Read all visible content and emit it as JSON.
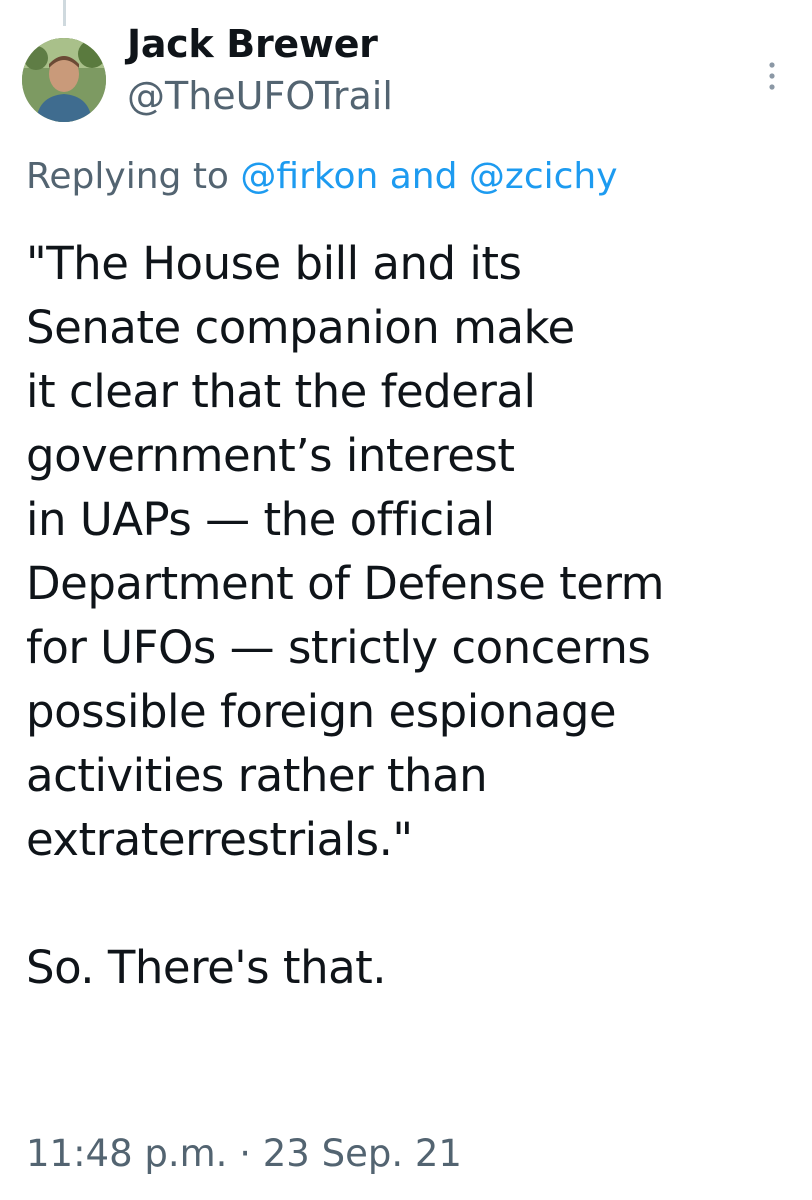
{
  "author": {
    "display_name": "Jack Brewer",
    "handle": "@TheUFOTrail",
    "avatar_icon": "profile-photo"
  },
  "reply": {
    "prefix": "Replying to ",
    "mentions": [
      "@firkon",
      "@zcichy"
    ],
    "joiner": " and "
  },
  "tweet": {
    "lines": [
      "\"The House bill and its",
      "Senate companion make",
      "it clear that the federal",
      "government’s interest",
      "in UAPs — the official",
      "Department of Defense term",
      "for UFOs — strictly concerns",
      "possible foreign espionage",
      "activities rather than",
      "extraterrestrials.\""
    ],
    "closing": "So. There's that."
  },
  "meta": {
    "time": "11:48 p.m.",
    "separator": " · ",
    "date": "23 Sep. 21"
  },
  "icons": {
    "more": "more-vertical-icon"
  },
  "colors": {
    "text": "#0f1419",
    "secondary": "#536471",
    "link": "#1d9bf0",
    "thread_line": "#cfd9de"
  }
}
